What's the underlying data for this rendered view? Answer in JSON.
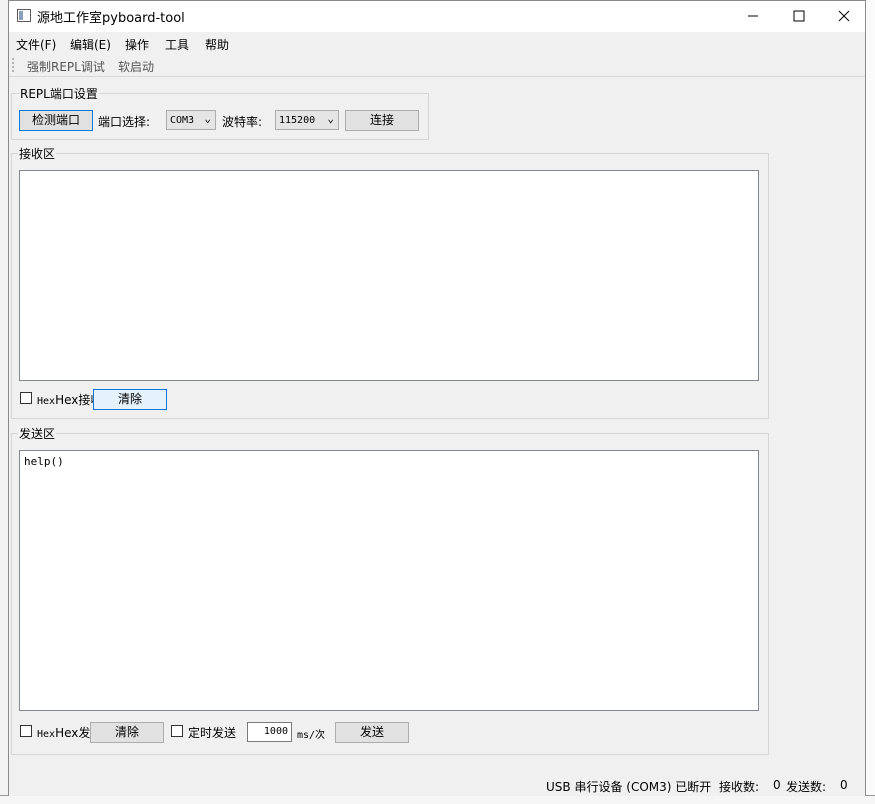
{
  "window": {
    "title": "源地工作室pyboard-tool"
  },
  "menu": [
    "文件(F)",
    "编辑(E)",
    "操作",
    "工具",
    "帮助"
  ],
  "toolbar": {
    "force_repl": "强制REPL调试",
    "soft_reboot": "软启动"
  },
  "repl": {
    "group_title": "REPL端口设置",
    "detect_button": "检测端口",
    "port_label": "端口选择:",
    "port_value": "COM3",
    "baud_label": "波特率:",
    "baud_value": "115200",
    "connect_button": "连接"
  },
  "receive": {
    "group_title": "接收区",
    "content": "",
    "hex_label": "Hex接收",
    "clear_button": "清除"
  },
  "send": {
    "group_title": "发送区",
    "content": "help()",
    "hex_label": "Hex发送",
    "clear_button": "清除",
    "timed_label": "定时发送",
    "interval_value": "1000",
    "interval_unit": "ms/次",
    "send_button": "发送"
  },
  "status": {
    "device": "USB 串行设备 (COM3) 已断开",
    "recv_label": "接收数:",
    "recv_count": "0",
    "send_label": "发送数:",
    "send_count": "0"
  },
  "icons": {
    "minimize": "minimize-icon",
    "maximize": "maximize-icon",
    "close": "close-icon",
    "dropdown": "chevron-down-icon"
  }
}
